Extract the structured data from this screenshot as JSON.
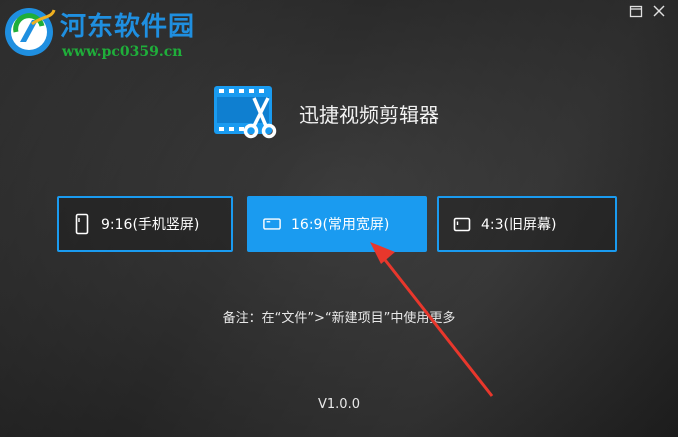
{
  "watermark": {
    "title": "河东软件园",
    "url": "www.pc0359.cn"
  },
  "app": {
    "name": "迅捷视频剪辑器",
    "version": "V1.0.0"
  },
  "ratios": [
    {
      "label": "9:16(手机竖屏)",
      "icon": "portrait-screen-icon",
      "selected": false
    },
    {
      "label": "16:9(常用宽屏)",
      "icon": "widescreen-icon",
      "selected": true
    },
    {
      "label": "4:3(旧屏幕)",
      "icon": "old-screen-icon",
      "selected": false
    }
  ],
  "note": "备注：在“文件”>“新建项目”中使用更多",
  "colors": {
    "accent": "#1a9bf0",
    "background": "#2b2b2b",
    "arrow": "#e8372c"
  }
}
